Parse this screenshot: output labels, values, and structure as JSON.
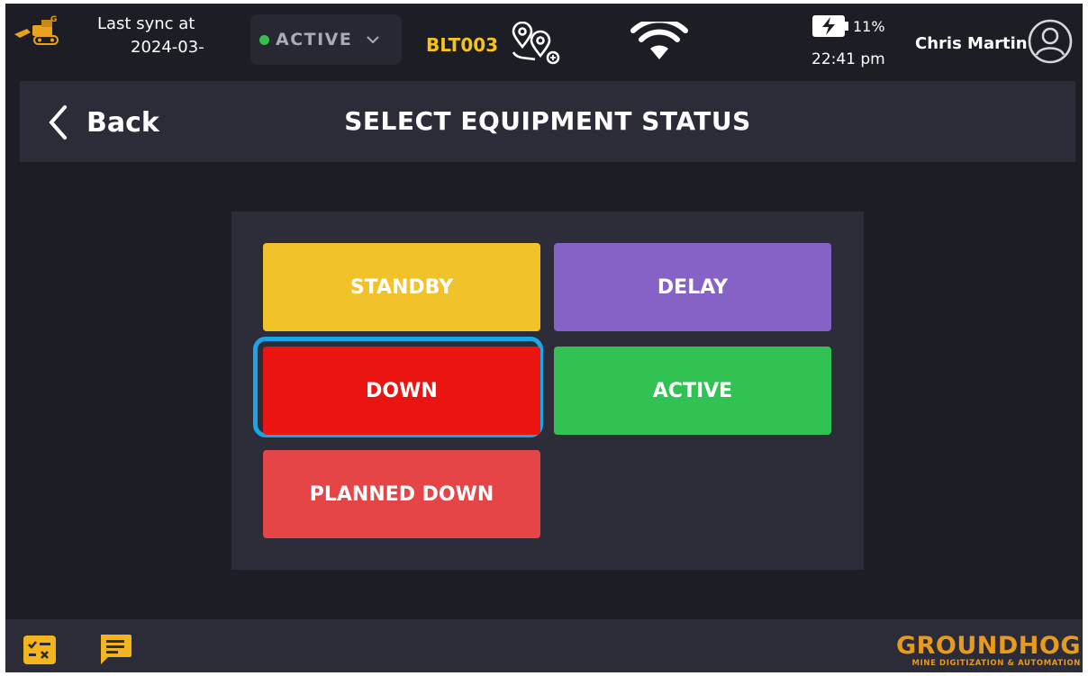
{
  "statusbar": {
    "logo_icon": "excavator-logo-icon",
    "sync_label": "Last sync at",
    "sync_date": "2024-03-",
    "equipment_status": "ACTIVE",
    "status_dot_color": "#35c04d",
    "equipment_id": "BLT003",
    "route_icon": "route-pins-icon",
    "wifi_icon": "wifi-icon",
    "battery_percent": "11%",
    "battery_icon": "battery-charging-icon",
    "time": "22:41 pm",
    "user_name": "Chris Martin",
    "avatar_icon": "user-avatar-icon"
  },
  "header": {
    "back_label": "Back",
    "title": "SELECT EQUIPMENT STATUS"
  },
  "options": {
    "standby": "STANDBY",
    "delay": "DELAY",
    "down": "DOWN",
    "active": "ACTIVE",
    "planned_down": "PLANNED DOWN",
    "selected": "DOWN",
    "colors": {
      "standby": "#f2c22a",
      "delay": "#8661c6",
      "down": "#ea1410",
      "active": "#32c254",
      "planned_down": "#e54547",
      "selection_ring": "#1aa6e6"
    }
  },
  "footer": {
    "tasks_icon": "checklist-icon",
    "chat_icon": "chat-icon",
    "brand_name": "GROUNDHOG",
    "brand_tagline": "MINE DIGITIZATION & AUTOMATION",
    "brand_color": "#e89a1c"
  }
}
